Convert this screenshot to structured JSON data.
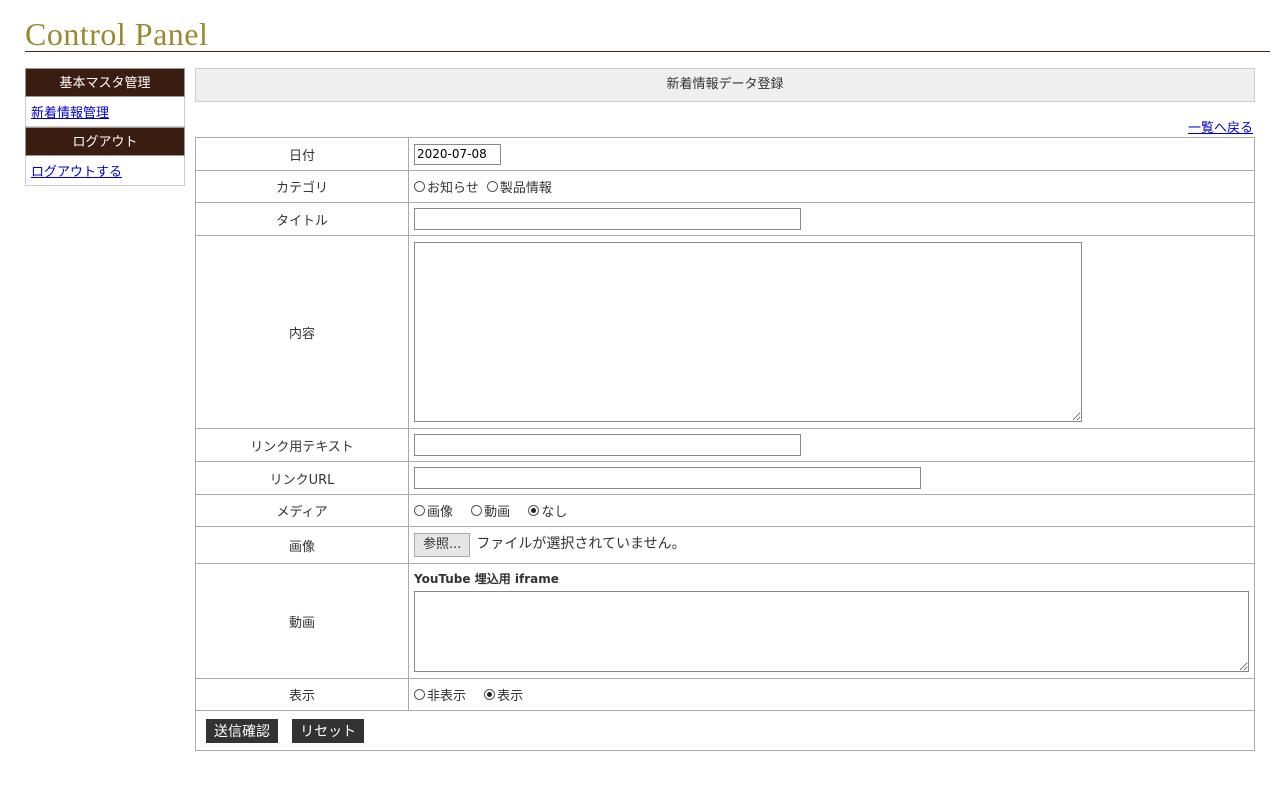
{
  "site": {
    "title": "Control Panel"
  },
  "sidebar": {
    "sections": [
      {
        "heading": "基本マスタ管理",
        "link": "新着情報管理"
      },
      {
        "heading": "ログアウト",
        "link": "ログアウトする"
      }
    ]
  },
  "form": {
    "heading": "新着情報データ登録",
    "back_link": "一覧へ戻る",
    "date": {
      "label": "日付",
      "value": "2020-07-08"
    },
    "category": {
      "label": "カテゴリ",
      "options": [
        "お知らせ",
        "製品情報"
      ],
      "selected": null
    },
    "title": {
      "label": "タイトル",
      "value": ""
    },
    "content": {
      "label": "内容",
      "value": ""
    },
    "link_text": {
      "label": "リンク用テキスト",
      "value": ""
    },
    "link_url": {
      "label": "リンクURL",
      "value": ""
    },
    "media": {
      "label": "メディア",
      "options": [
        "画像",
        "動画",
        "なし"
      ],
      "selected": "なし"
    },
    "image": {
      "label": "画像",
      "button": "参照...",
      "status": "ファイルが選択されていません。"
    },
    "video": {
      "label": "動画",
      "sub_label": "YouTube 埋込用 iframe",
      "value": ""
    },
    "display": {
      "label": "表示",
      "options": [
        "非表示",
        "表示"
      ],
      "selected": "表示"
    },
    "submit_label": "送信確認",
    "reset_label": "リセット"
  }
}
